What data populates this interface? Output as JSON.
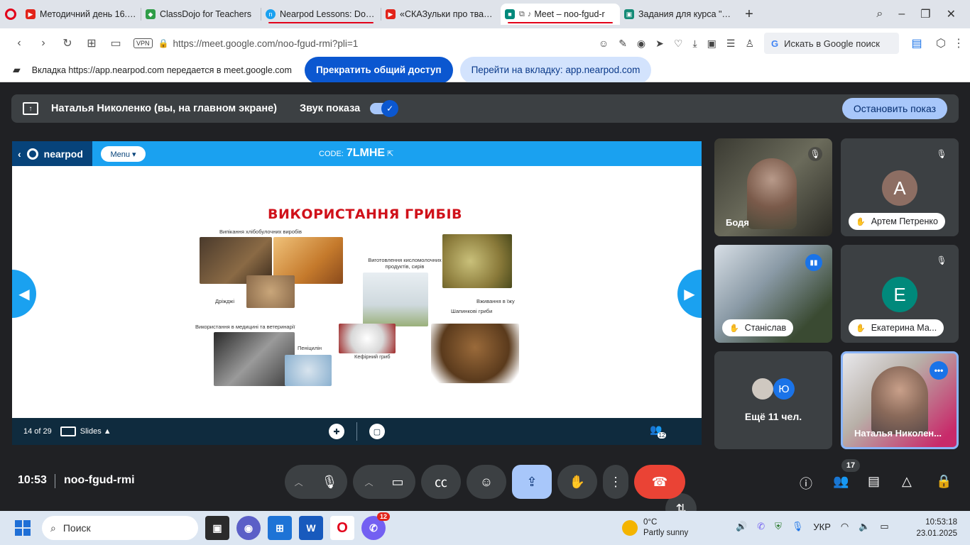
{
  "browser": {
    "tabs": [
      {
        "title": "Методичний день 16.01 -",
        "color": "#e2231a",
        "icon": "youtube-icon"
      },
      {
        "title": "ClassDojo for Teachers",
        "color": "#2e9d47",
        "icon": "classdojo-icon"
      },
      {
        "title": "Nearpod Lessons: Downlo",
        "color": "#1aa1f0",
        "icon": "nearpod-icon"
      },
      {
        "title": "«СКАЗульки про тварин»",
        "color": "#e2231a",
        "icon": "youtube-icon"
      },
      {
        "title": "Meet – noo-fgud-r",
        "color": "#00897b",
        "icon": "meet-icon"
      },
      {
        "title": "Задания для курса \"3 кла",
        "color": "#138a76",
        "icon": "classroom-icon"
      }
    ],
    "new_tab": "+",
    "url": "https://meet.google.com/noo-fgud-rmi?pli=1",
    "vpn": "VPN",
    "search_placeholder": "Искать в Google поиск",
    "search_g": "G"
  },
  "sharebar": {
    "message": "Вкладка https://app.nearpod.com передается в meet.google.com",
    "stop_share": "Прекратить общий доступ",
    "switch_tab": "Перейти на вкладку: app.nearpod.com"
  },
  "present": {
    "who": "Наталья Николенко (вы, на главном экране)",
    "sound_label": "Звук показа",
    "stop_button": "Остановить показ"
  },
  "nearpod": {
    "logo": "nearpod",
    "menu": "Menu ▾",
    "code_label": "CODE:",
    "code": "7LMHE",
    "page": "14 of 29",
    "slides_label": "Slides ▲",
    "participants_count": "12"
  },
  "slide": {
    "title": "ВИКОРИСТАННЯ ГРИБІВ",
    "labels": {
      "baking": "Випікання хлібобулочних виробів",
      "dairy": "Виготовлення кисломолочних продуктів, сирів",
      "yeast": "Дріжджі",
      "food": "Вживання в їжу",
      "champignons": "Шапинкові гриби",
      "medicine": "Використання в медицині та ветеринарії",
      "penicillin": "Пеніцилін",
      "kefir": "Кефірний гриб"
    }
  },
  "participants": [
    {
      "name": "Бодя",
      "type": "video"
    },
    {
      "name": "Артем Петренко",
      "initial": "А",
      "color": "#8d6e63",
      "type": "avatar"
    },
    {
      "name": "Станіслав",
      "type": "video"
    },
    {
      "name": "Екатерина Ма...",
      "initial": "Е",
      "color": "#00897b",
      "type": "avatar"
    },
    {
      "name": "Ещё 11 чел.",
      "initial": "Ю",
      "type": "more"
    },
    {
      "name": "Наталья Николен...",
      "type": "video"
    }
  ],
  "meet": {
    "time": "10:53",
    "code": "noo-fgud-rmi",
    "people_count": "17"
  },
  "taskbar": {
    "search": "Поиск",
    "viber_count": "12",
    "temp": "0°C",
    "weather": "Partly sunny",
    "lang": "УКР",
    "time": "10:53:18",
    "date": "23.01.2025"
  }
}
